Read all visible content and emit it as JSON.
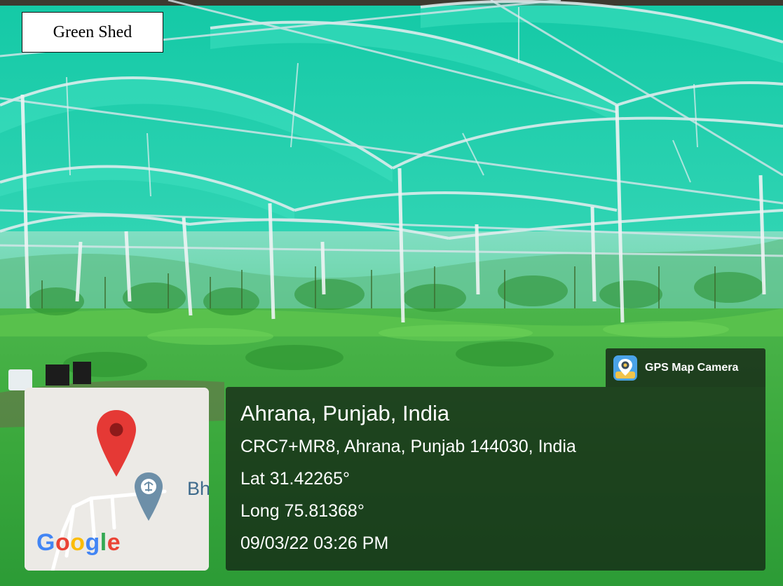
{
  "caption": "Green Shed",
  "stamp": {
    "app_name": "GPS Map Camera",
    "place": "Ahrana, Punjab, India",
    "address": "CRC7+MR8, Ahrana, Punjab 144030, India",
    "lat": "Lat 31.42265°",
    "long": "Long 75.81368°",
    "datetime": "09/03/22 03:26 PM"
  },
  "map": {
    "partial_label": "Bha",
    "logo": "Google",
    "logo_letters": [
      "G",
      "o",
      "o",
      "g",
      "l",
      "e"
    ],
    "logo_colors": [
      "#4285F4",
      "#EA4335",
      "#FBBC05",
      "#4285F4",
      "#34A853",
      "#EA4335"
    ],
    "pin_color": "#e53935",
    "poi_color": "#6d8fa8",
    "icons": [
      "location-pin-icon",
      "place-of-worship-icon"
    ]
  },
  "colors": {
    "shade_net": "#1fd4a8",
    "crop_green": "#3aa83c"
  }
}
